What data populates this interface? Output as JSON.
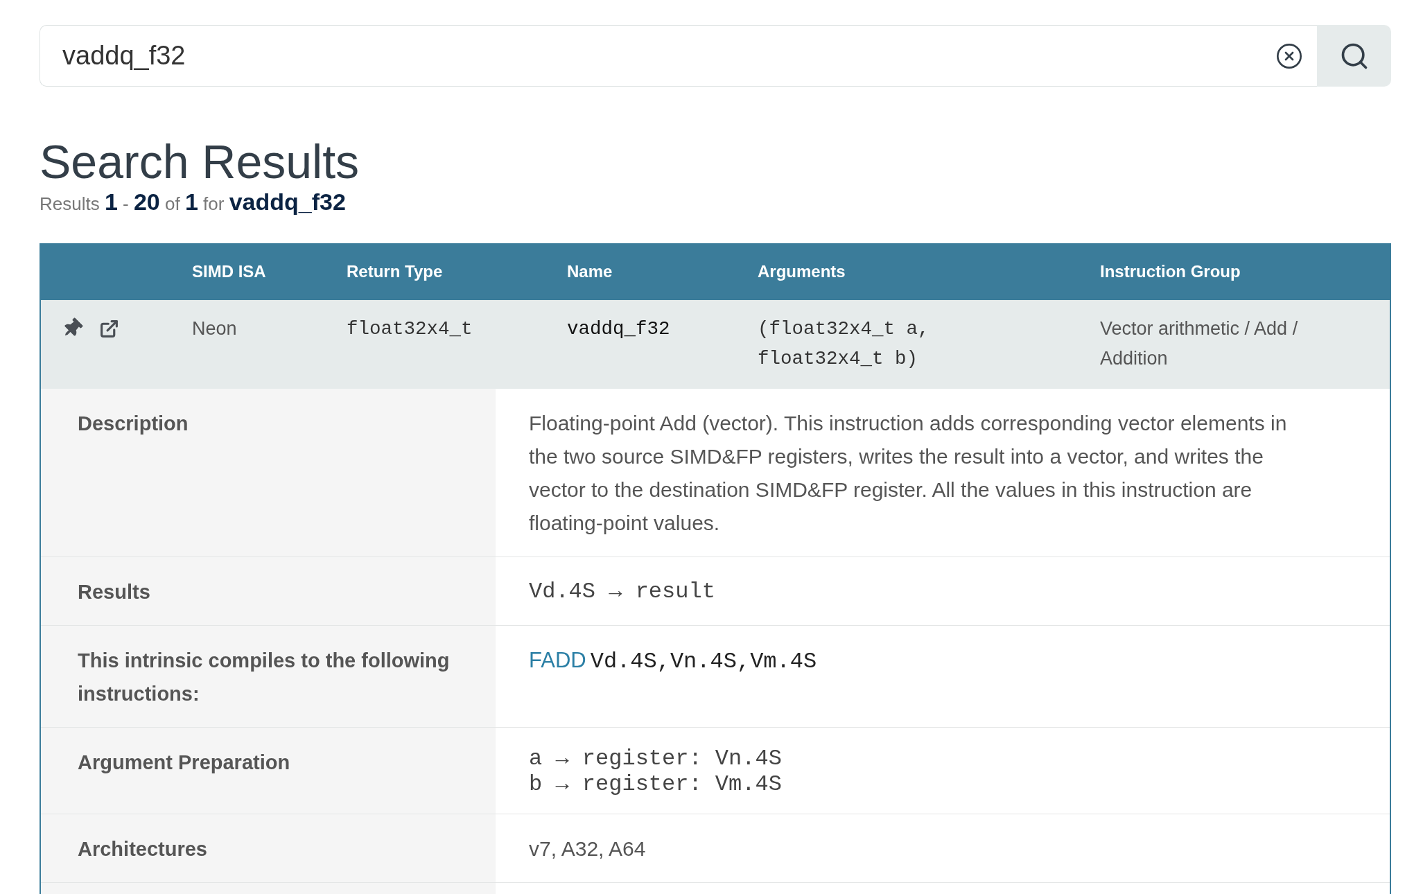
{
  "search": {
    "value": "vaddq_f32"
  },
  "heading": "Search Results",
  "summary": "Results **1** - **20** of **1** for **vaddq_f32**",
  "table": {
    "columns": [
      "SIMD ISA",
      "Return Type",
      "Name",
      "Arguments",
      "Instruction Group"
    ],
    "rows": [
      {
        "simd_isa": "Neon",
        "return_type": "float32x4_t",
        "name": "vaddq_f32",
        "arguments": "(float32x4_t a, float32x4_t b)",
        "instruction_group": "Vector arithmetic / Add / Addition"
      }
    ]
  },
  "details": [
    {
      "kind": "text",
      "label": "Description",
      "value": "Floating-point Add (vector). This instruction adds corresponding vector elements in the two source SIMD&FP registers, writes the result into a vector, and writes the vector to the destination SIMD&FP register. All the values in this instruction are floating-point values."
    },
    {
      "kind": "code",
      "label": "Results",
      "value": "Vd.4S → result"
    },
    {
      "kind": "instruction",
      "label": "This intrinsic compiles to the following instructions:",
      "mnemonic": "FADD",
      "operands": "Vd.4S,Vn.4S,Vm.4S"
    },
    {
      "kind": "code_lines",
      "label": "Argument Preparation",
      "lines": [
        "a → register: Vn.4S",
        "b → register: Vm.4S"
      ]
    },
    {
      "kind": "text",
      "label": "Architectures",
      "value": "v7, A32, A64"
    }
  ]
}
